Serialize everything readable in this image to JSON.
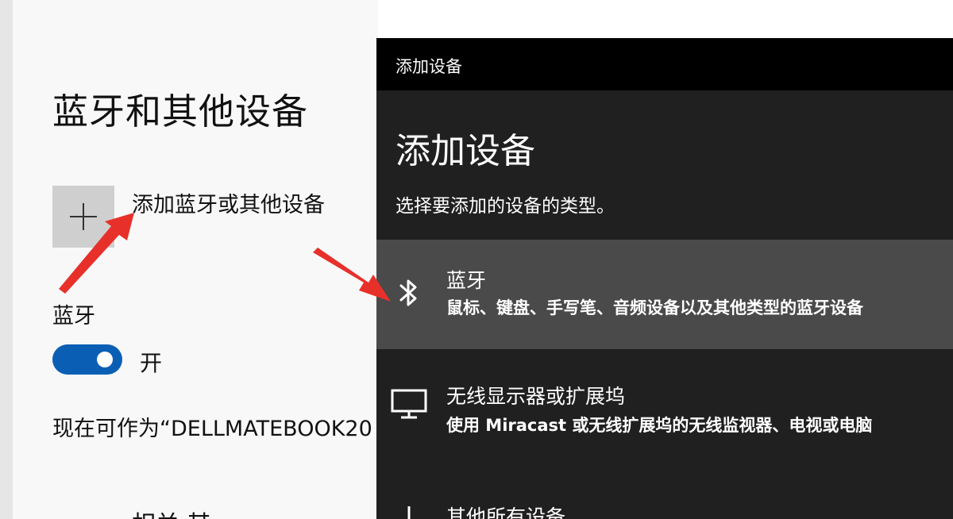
{
  "settings": {
    "title": "蓝牙和其他设备",
    "add_device_label": "添加蓝牙或其他设备",
    "bluetooth_label": "蓝牙",
    "bluetooth_toggle_state": "开",
    "discoverable_text": "现在可作为“DELLMATEBOOK20",
    "cut_off_text": "相关 其"
  },
  "dialog": {
    "window_title": "添加设备",
    "heading": "添加设备",
    "subtitle": "选择要添加的设备的类型。",
    "options": [
      {
        "icon": "bluetooth-icon",
        "title": "蓝牙",
        "description": "鼠标、键盘、手写笔、音频设备以及其他类型的蓝牙设备",
        "selected": true
      },
      {
        "icon": "monitor-icon",
        "title": "无线显示器或扩展坞",
        "description": "使用 Miracast 或无线扩展坞的无线监视器、电视或电脑",
        "selected": false
      },
      {
        "icon": "plus-icon",
        "title": "其他所有设备",
        "description": "",
        "selected": false
      }
    ]
  },
  "colors": {
    "accent": "#0a5fb4",
    "dialog_background": "#202020",
    "titlebar": "#000000",
    "selected_row": "#4a4a4a",
    "annotation_arrow": "#e8302a"
  }
}
